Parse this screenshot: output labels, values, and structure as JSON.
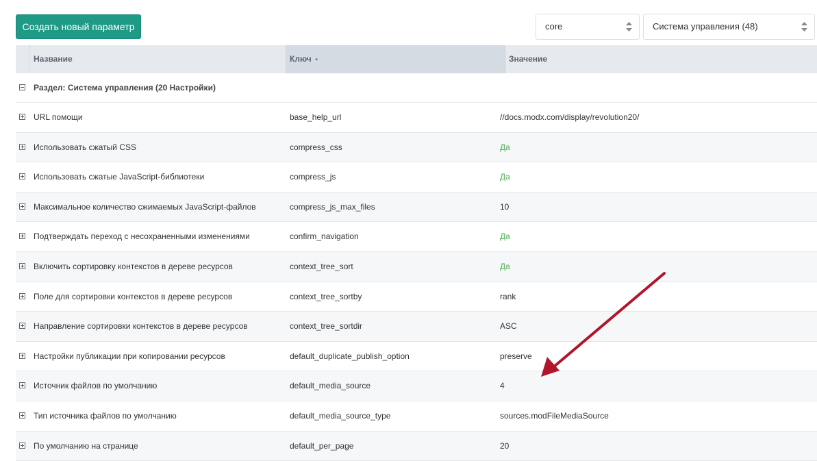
{
  "toolbar": {
    "create_label": "Создать новый параметр",
    "namespace_value": "core",
    "area_value": "Система управления (48)"
  },
  "grid": {
    "columns": {
      "name": "Название",
      "key": "Ключ",
      "value": "Значение"
    },
    "group_label": "Раздел: Система управления (20 Настройки)",
    "rows": [
      {
        "name": "URL помощи",
        "key": "base_help_url",
        "value": "//docs.modx.com/display/revolution20/"
      },
      {
        "name": "Использовать сжатый CSS",
        "key": "compress_css",
        "value": "Да"
      },
      {
        "name": "Использовать сжатые JavaScript-библиотеки",
        "key": "compress_js",
        "value": "Да"
      },
      {
        "name": "Максимальное количество сжимаемых JavaScript-файлов",
        "key": "compress_js_max_files",
        "value": "10"
      },
      {
        "name": "Подтверждать переход с несохраненными изменениями",
        "key": "confirm_navigation",
        "value": "Да"
      },
      {
        "name": "Включить сортировку контекстов в дереве ресурсов",
        "key": "context_tree_sort",
        "value": "Да"
      },
      {
        "name": "Поле для сортировки контекстов в дереве ресурсов",
        "key": "context_tree_sortby",
        "value": "rank"
      },
      {
        "name": "Направление сортировки контекстов в дереве ресурсов",
        "key": "context_tree_sortdir",
        "value": "ASC"
      },
      {
        "name": "Настройки публикации при копировании ресурсов",
        "key": "default_duplicate_publish_option",
        "value": "preserve"
      },
      {
        "name": "Источник файлов по умолчанию",
        "key": "default_media_source",
        "value": "4"
      },
      {
        "name": "Тип источника файлов по умолчанию",
        "key": "default_media_source_type",
        "value": "sources.modFileMediaSource"
      },
      {
        "name": "По умолчанию на странице",
        "key": "default_per_page",
        "value": "20"
      }
    ]
  },
  "colors": {
    "accent": "#1f9a86",
    "yes_value": "#4caf50",
    "annotation_arrow": "#b0152a"
  },
  "icons": {
    "sort": "sort-asc-icon",
    "expand": "plus-box-icon",
    "collapse": "minus-box-icon",
    "select_arrows": "updown-arrows-icon"
  }
}
